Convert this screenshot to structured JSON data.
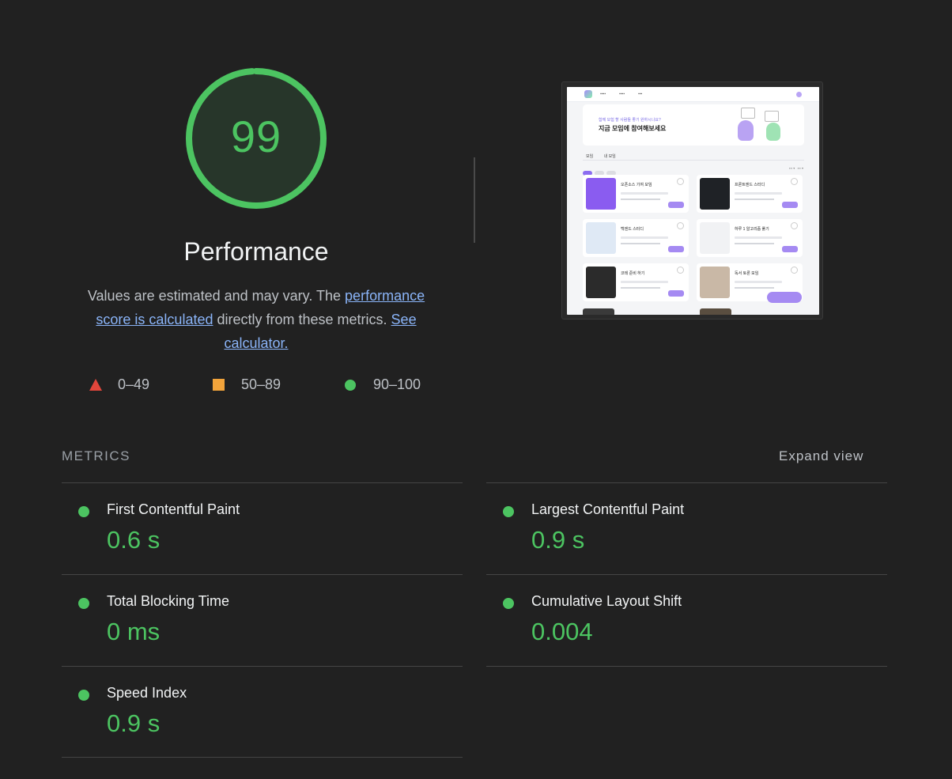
{
  "score": {
    "value": "99",
    "fraction": 0.99,
    "title": "Performance",
    "color": "#4cc461"
  },
  "description": {
    "prefix": "Values are estimated and may vary. The ",
    "link1": "performance score is calculated",
    "middle": " directly from these metrics. ",
    "link2": "See calculator."
  },
  "legend": {
    "fail": "0–49",
    "average": "50–89",
    "pass": "90–100",
    "colors": {
      "fail": "#e2463b",
      "average": "#f2a43b",
      "pass": "#4cc461"
    }
  },
  "screenshot_thumb": {
    "banner_sub": "함께 모험 할 사람들 좋기 원하시나요?",
    "banner_title": "지금 모임에 참여해보세요",
    "tabs": [
      "모임",
      "내 모임"
    ],
    "cards": [
      {
        "title": "오픈소스 기여 모임"
      },
      {
        "title": "프론트엔드 스터디"
      },
      {
        "title": "백엔드 스터디"
      },
      {
        "title": "하루 1 알고리즘 풀기"
      },
      {
        "title": "코테 준비 하기"
      },
      {
        "title": "독서 토론 모임"
      }
    ]
  },
  "metrics": {
    "title": "METRICS",
    "expand_label": "Expand view",
    "items": [
      {
        "label": "First Contentful Paint",
        "value": "0.6 s"
      },
      {
        "label": "Largest Contentful Paint",
        "value": "0.9 s"
      },
      {
        "label": "Total Blocking Time",
        "value": "0 ms"
      },
      {
        "label": "Cumulative Layout Shift",
        "value": "0.004"
      },
      {
        "label": "Speed Index",
        "value": "0.9 s"
      }
    ]
  }
}
